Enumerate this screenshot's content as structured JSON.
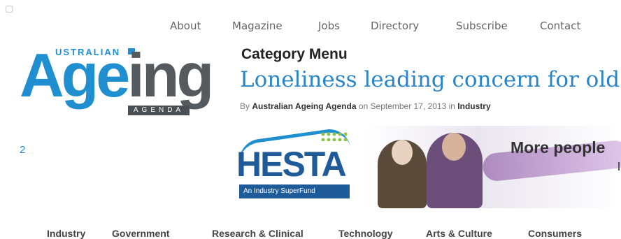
{
  "top_nav": [
    "About",
    "Magazine",
    "Jobs",
    "Directory",
    "Subscribe",
    "Contact"
  ],
  "logo": {
    "top_text": "USTRALIAN",
    "word_a": "Age",
    "word_b": "ing",
    "agenda": "AGENDA"
  },
  "page_number": "2",
  "category_menu": "Category Menu",
  "article": {
    "title": "Loneliness leading concern for old",
    "byline_prefix": "By",
    "author": "Australian Ageing Agenda",
    "date_text": "on September 17, 2013 in",
    "category": "Industry"
  },
  "ad": {
    "brand": "HESTA",
    "tagline": "An Industry SuperFund",
    "headline": "More people"
  },
  "category_nav": [
    "Industry",
    "Government",
    "Research & Clinical",
    "Technology",
    "Arts & Culture",
    "Consumers"
  ],
  "colors": {
    "brand_blue": "#1f8fd0",
    "title_blue": "#2a85c6",
    "logo_gray": "#555a5e"
  }
}
